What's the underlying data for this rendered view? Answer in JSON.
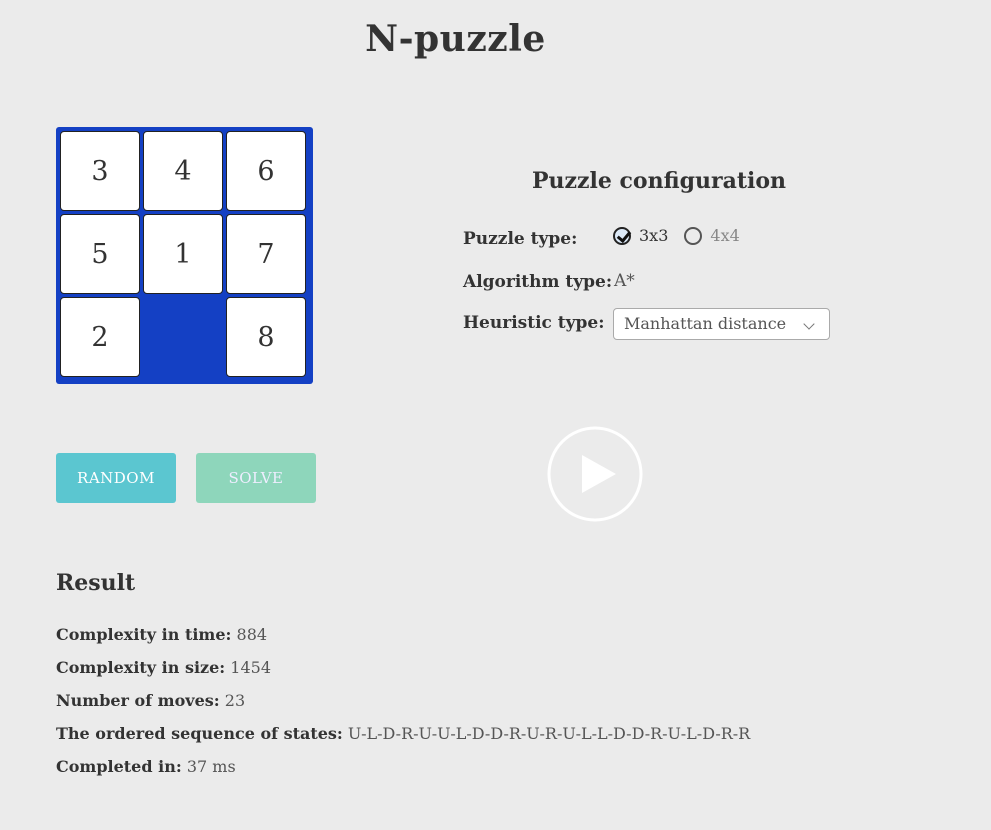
{
  "title": "N-puzzle",
  "board": {
    "tiles": [
      "3",
      "4",
      "6",
      "5",
      "1",
      "7",
      "2",
      "",
      "8"
    ],
    "color": "#1440c4"
  },
  "config": {
    "title": "Puzzle configuration",
    "puzzle_type_label": "Puzzle type:",
    "options": [
      "3x3",
      "4x4"
    ],
    "selected": "3x3",
    "algorithm_label": "Algorithm type:",
    "algorithm_value": "A*",
    "heuristic_label": "Heuristic type:",
    "heuristic_value": "Manhattan distance"
  },
  "buttons": {
    "random": "RANDOM",
    "solve": "SOLVE"
  },
  "icons": {
    "play": "play-icon"
  },
  "result": {
    "title": "Result",
    "time_label": "Complexity in time:",
    "time_value": "884",
    "size_label": "Complexity in size:",
    "size_value": "1454",
    "moves_label": "Number of moves:",
    "moves_value": "23",
    "sequence_label": "The ordered sequence of states:",
    "sequence_value": "U-L-D-R-U-U-L-D-D-R-U-R-U-L-L-D-D-R-U-L-D-R-R",
    "completed_label": "Completed in:",
    "completed_value": "37 ms"
  }
}
